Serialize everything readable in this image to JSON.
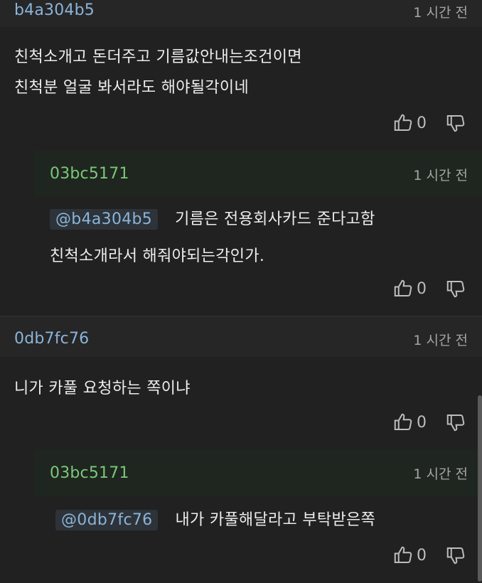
{
  "comments": [
    {
      "author": "b4a304b5",
      "time": "1 시간 전",
      "lines": [
        "친척소개고 돈더주고 기름값안내는조건이면",
        "친척분 얼굴 봐서라도 해야될각이네"
      ],
      "likes": "0"
    },
    {
      "author": "03bc5171",
      "time": "1 시간 전",
      "mention": "@b4a304b5",
      "lines": [
        "기름은 전용회사카드 준다고함",
        "친척소개라서 해줘야되는각인가."
      ],
      "likes": "0"
    },
    {
      "author": "0db7fc76",
      "time": "1 시간 전",
      "lines": [
        "니가 카풀 요청하는 쪽이냐"
      ],
      "likes": "0"
    },
    {
      "author": "03bc5171",
      "time": "1 시간 전",
      "mention": "@0db7fc76",
      "lines": [
        "내가 카풀해달라고 부탁받은쪽"
      ],
      "likes": "0"
    }
  ],
  "icons": {
    "like": "thumbs-up-icon",
    "dislike": "thumbs-down-icon"
  },
  "colors": {
    "background": "#212121",
    "author_blue": "#8ab4da",
    "author_green": "#7bc77b",
    "reply_band": "#1f261f",
    "mention_bg": "#2d3338"
  }
}
